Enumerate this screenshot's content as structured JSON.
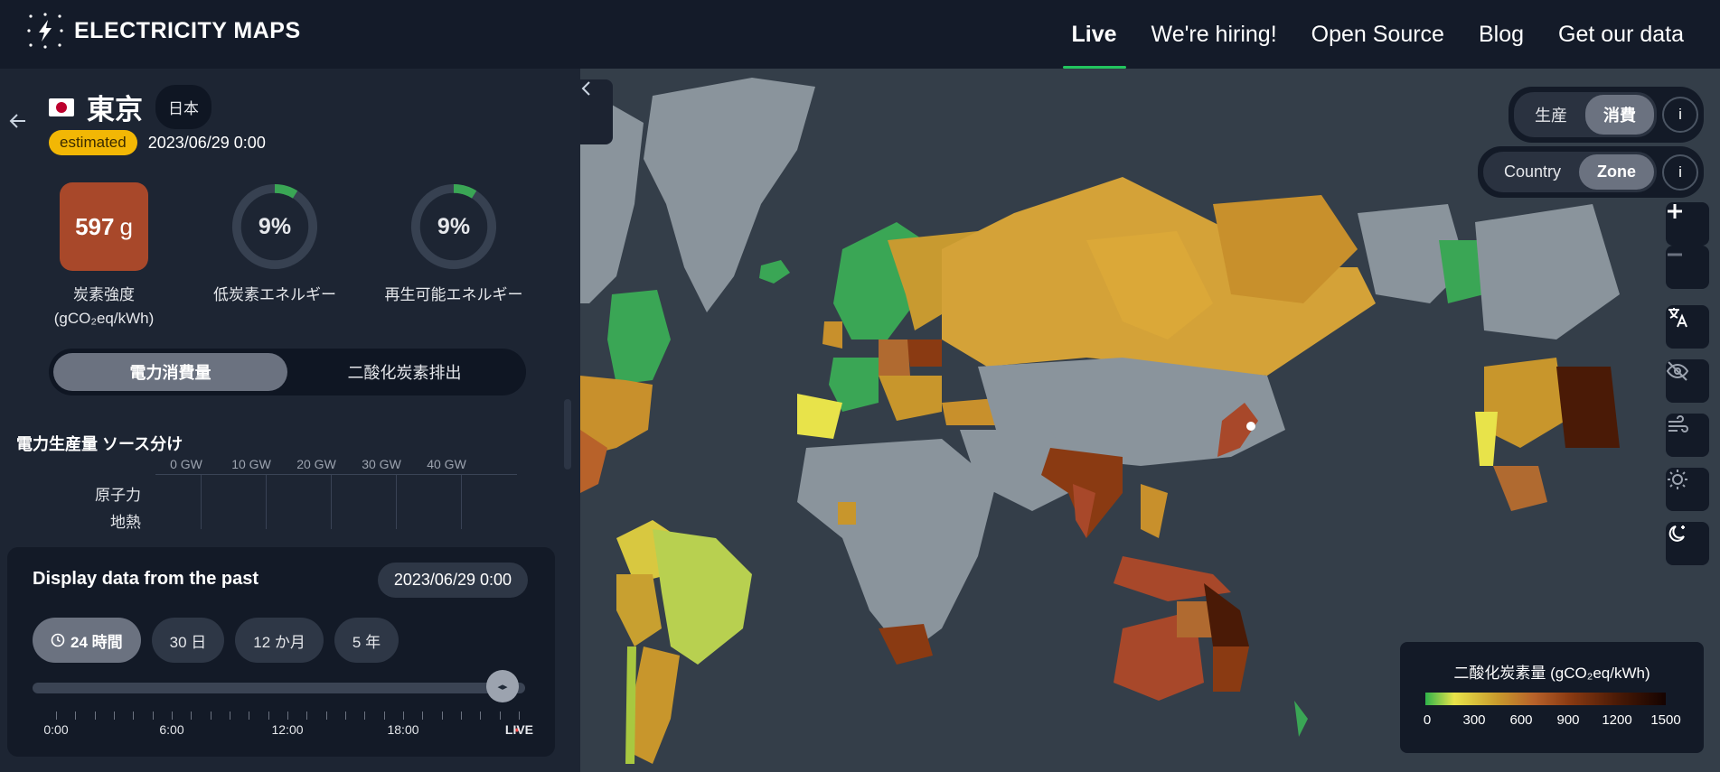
{
  "app": {
    "name": "ELECTRICITY MAPS"
  },
  "nav": [
    {
      "label": "Live",
      "active": true
    },
    {
      "label": "We're hiring!"
    },
    {
      "label": "Open Source"
    },
    {
      "label": "Blog"
    },
    {
      "label": "Get our data"
    }
  ],
  "zone": {
    "name": "東京",
    "country": "日本",
    "flag": "JP",
    "status_badge": "estimated",
    "datetime": "2023/06/29 0:00"
  },
  "metrics": {
    "carbon_value": "597",
    "carbon_unit": "g",
    "carbon_color": "#a8482a",
    "carbon_label_1": "炭素強度",
    "carbon_label_2": "(gCO₂eq/kWh)",
    "low_carbon_pct": "9%",
    "low_carbon_fraction": 0.09,
    "low_carbon_label": "低炭素エネルギー",
    "renewable_pct": "9%",
    "renewable_fraction": 0.09,
    "renewable_label": "再生可能エネルギー"
  },
  "view_toggle": {
    "consumption": "電力消費量",
    "emissions": "二酸化炭素排出",
    "selected": "consumption"
  },
  "breakdown": {
    "title": "電力生産量 ソース分け",
    "axis": [
      "0 GW",
      "10 GW",
      "20 GW",
      "30 GW",
      "40 GW"
    ],
    "sources": [
      "原子力",
      "地熱"
    ]
  },
  "time_controls": {
    "title": "Display data from the past",
    "current": "2023/06/29 0:00",
    "ranges": [
      {
        "label": "24 時間",
        "selected": true
      },
      {
        "label": "30 日"
      },
      {
        "label": "12 か月"
      },
      {
        "label": "5 年"
      }
    ],
    "tick_labels": [
      "0:00",
      "6:00",
      "12:00",
      "18:00"
    ],
    "live_label": "LIVE",
    "slider_position": 1.0
  },
  "map_controls": {
    "production_label": "生産",
    "consumption_label": "消費",
    "mode_selected": "consumption",
    "country_label": "Country",
    "zone_label": "Zone",
    "granularity_selected": "zone",
    "info": "i",
    "tools": [
      "zoom-in-icon",
      "zoom-out-icon",
      "language-icon",
      "hide-icon",
      "wind-icon",
      "sun-icon",
      "moon-icon"
    ]
  },
  "legend": {
    "title": "二酸化炭素量 (gCO₂eq/kWh)",
    "ticks": [
      "0",
      "300",
      "600",
      "900",
      "1200",
      "1500"
    ]
  }
}
